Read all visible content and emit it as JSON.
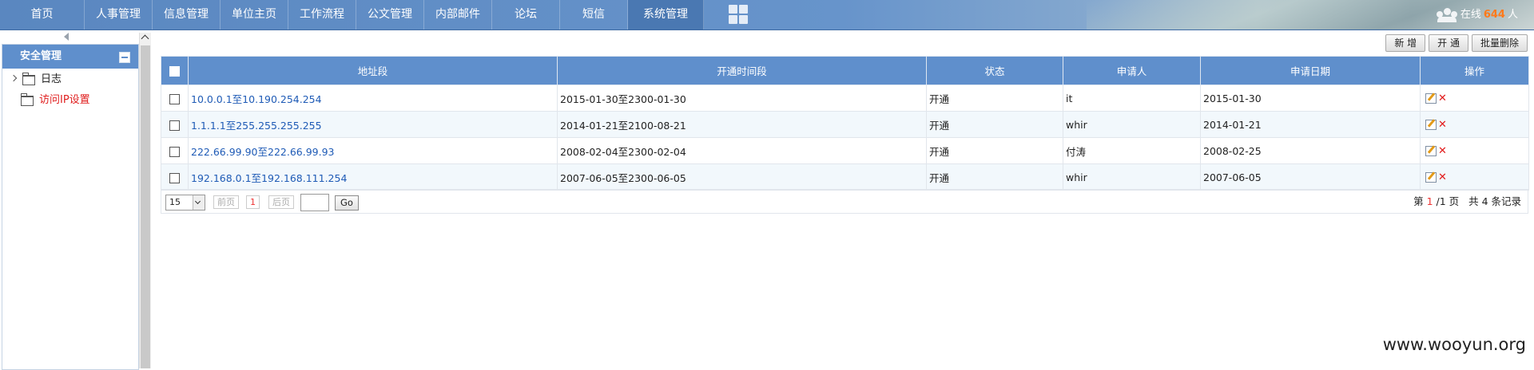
{
  "nav": {
    "items": [
      "首页",
      "人事管理",
      "信息管理",
      "单位主页",
      "工作流程",
      "公文管理",
      "内部邮件",
      "论坛",
      "短信",
      "系统管理"
    ],
    "active_index": 9,
    "online_prefix": "在线",
    "online_count": "644",
    "online_suffix": "人"
  },
  "sidebar": {
    "title": "安全管理",
    "items": [
      {
        "label": "日志",
        "color": "#222222"
      },
      {
        "label": "访问IP设置",
        "color": "#e02020"
      }
    ]
  },
  "toolbar": {
    "add_label": "新 增",
    "open_label": "开 通",
    "batch_delete_label": "批量删除"
  },
  "table": {
    "headers": [
      "地址段",
      "开通时间段",
      "状态",
      "申请人",
      "申请日期",
      "操作"
    ],
    "rows": [
      [
        "10.0.0.1至10.190.254.254",
        "2015-01-30至2300-01-30",
        "开通",
        "it",
        "2015-01-30"
      ],
      [
        "1.1.1.1至255.255.255.255",
        "2014-01-21至2100-08-21",
        "开通",
        "whir",
        "2014-01-21"
      ],
      [
        "222.66.99.90至222.66.99.93",
        "2008-02-04至2300-02-04",
        "开通",
        "付涛",
        "2008-02-25"
      ],
      [
        "192.168.0.1至192.168.111.254",
        "2007-06-05至2300-06-05",
        "开通",
        "whir",
        "2007-06-05"
      ]
    ]
  },
  "pager": {
    "page_size": "15",
    "prev_label": "前页",
    "current_page": "1",
    "next_label": "后页",
    "go_label": "Go",
    "info_prefix": "第",
    "info_current": "1",
    "info_total_pages": "/1 页",
    "info_records": "共 4 条记录"
  },
  "watermark": "www.wooyun.org",
  "colors": {
    "header_blue": "#5f8fcc",
    "link_blue": "#1f5bb6",
    "accent_red": "#e02020",
    "online_orange": "#ff7a1a"
  }
}
